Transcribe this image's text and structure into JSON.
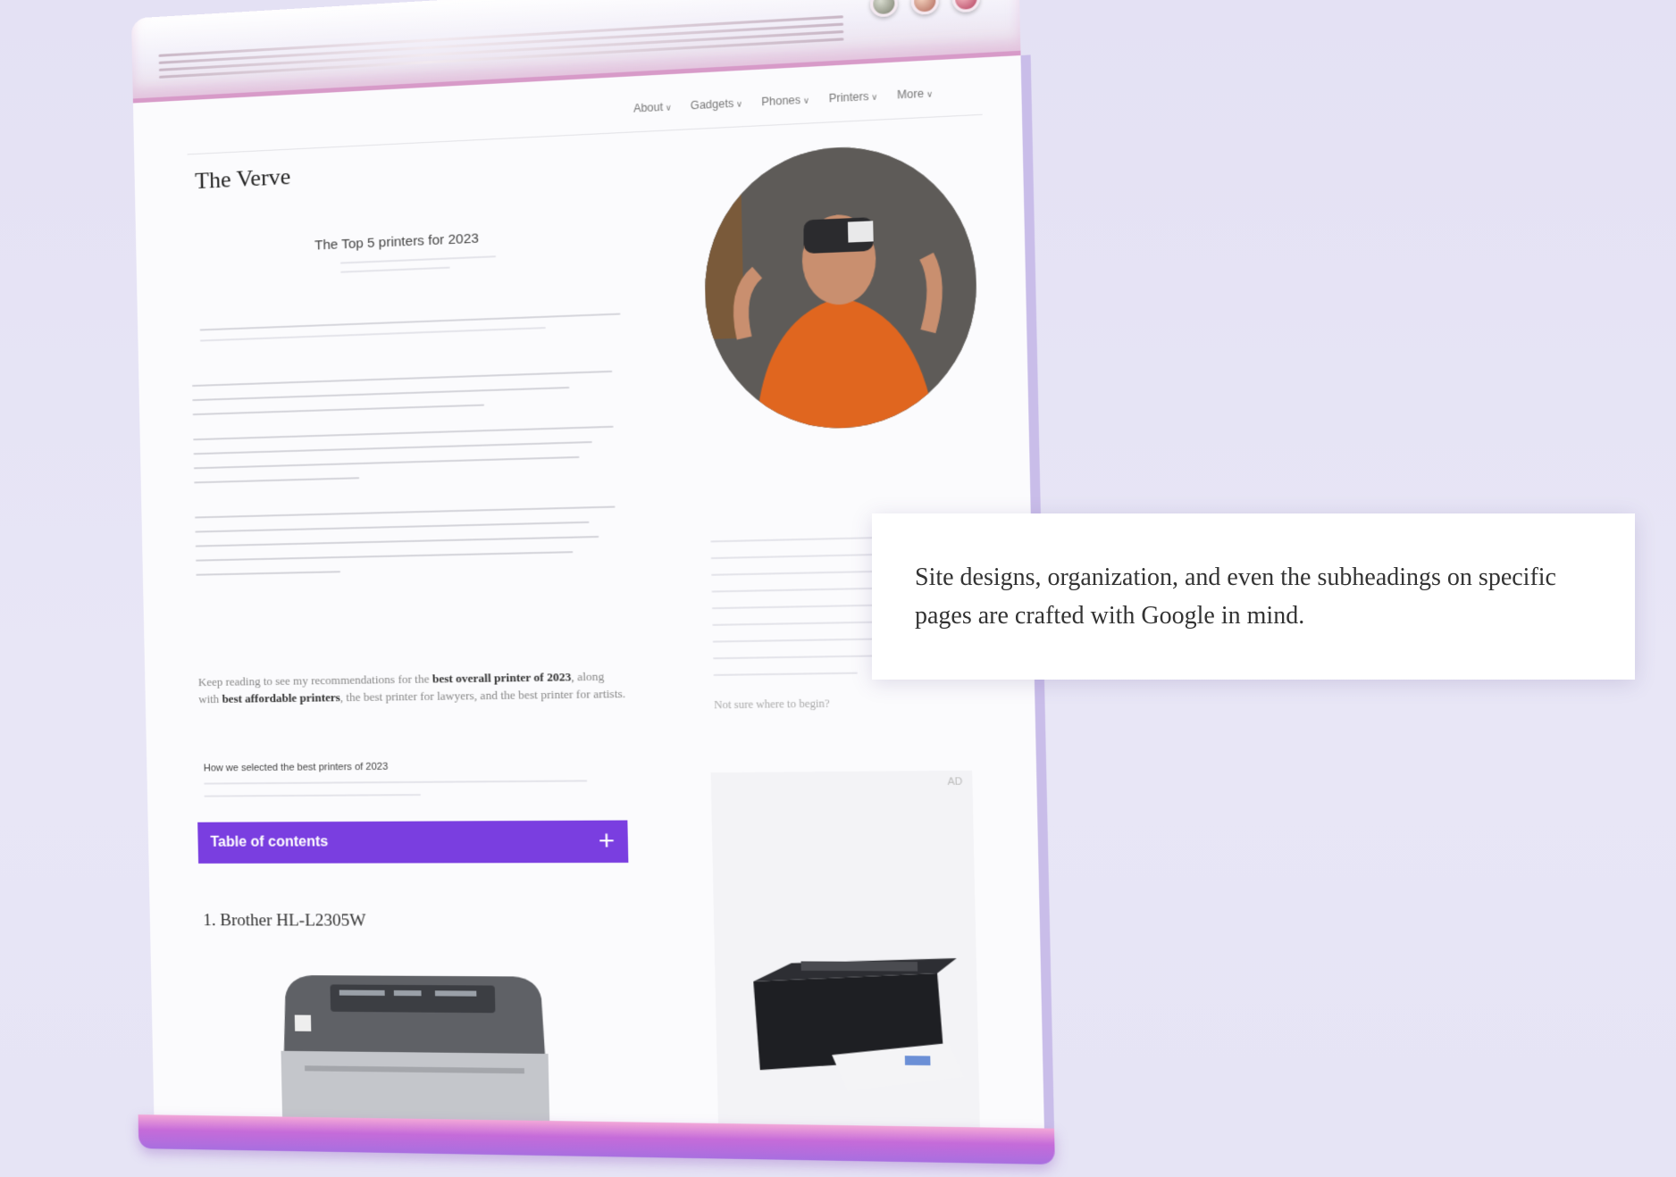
{
  "browser": {
    "window_controls": [
      "minimize-button",
      "maximize-button",
      "close-button"
    ]
  },
  "site": {
    "title": "The Verve",
    "nav": [
      "About",
      "Gadgets",
      "Phones",
      "Printers",
      "More"
    ]
  },
  "article": {
    "title": "The Top 5 printers for 2023",
    "para_keep_reading_prefix": "Keep reading to see my recommendations for the ",
    "best_overall": "best overall printer of 2023",
    "para_mid": ", along with ",
    "best_affordable": "best affordable printers",
    "para_mid2": ", the best printer for lawyers, and the best printer for artists.",
    "how_selected": "How we selected the best printers of 2023",
    "toc_label": "Table of contents",
    "toc_icon": "plus-icon",
    "item_1": "1. Brother HL-L2305W",
    "not_sure": "Not sure where to begin? "
  },
  "sidebar": {
    "ad_label": "AD"
  },
  "callout": {
    "text": "Site designs, organization, and even the subheadings on specific pages are crafted with Google in mind."
  },
  "colors": {
    "toc_background": "#7a3ee0",
    "bottom_bar": "#c56bd9",
    "background": "#e5e3f5"
  }
}
